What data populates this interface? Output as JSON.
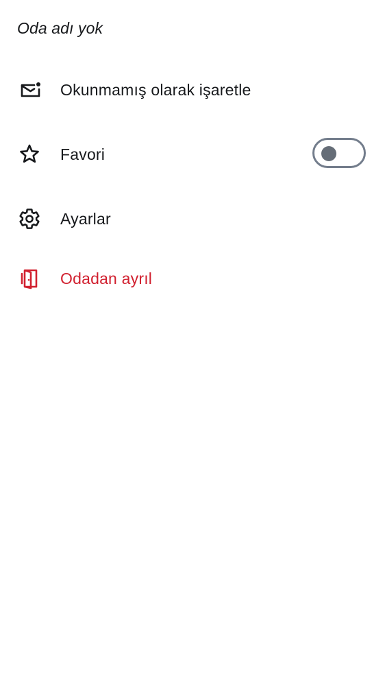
{
  "room": {
    "title": "Oda adı yok"
  },
  "menu": {
    "mark_unread": {
      "label": "Okunmamış olarak işaretle",
      "icon": "mail-unread-icon"
    },
    "favourite": {
      "label": "Favori",
      "icon": "star-icon",
      "toggle_on": false
    },
    "settings": {
      "label": "Ayarlar",
      "icon": "gear-icon"
    },
    "leave": {
      "label": "Odadan ayrıl",
      "icon": "leave-door-icon"
    }
  },
  "colors": {
    "text": "#17191c",
    "danger": "#d1202f",
    "toggle_border": "#737d8c",
    "toggle_knob": "#656d77",
    "background": "#ffffff"
  }
}
